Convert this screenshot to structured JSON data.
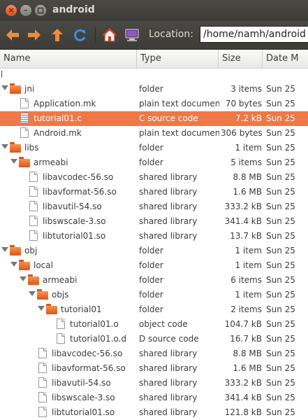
{
  "window": {
    "title": "android",
    "close_glyph": "×",
    "min_glyph": "–"
  },
  "toolbar": {
    "location_label": "Location:",
    "location_value": "/home/namh/android"
  },
  "columns": {
    "name": "Name",
    "type": "Type",
    "size": "Size",
    "date": "Date M"
  },
  "rows": [
    {
      "name": "jni",
      "type": "folder",
      "size": "3 items",
      "date": "Sun 25",
      "depth": 0,
      "kind": "folder",
      "expanded": true
    },
    {
      "name": "Application.mk",
      "type": "plain text document",
      "size": "70 bytes",
      "date": "Sun 25",
      "depth": 1,
      "kind": "file"
    },
    {
      "name": "tutorial01.c",
      "type": "C source code",
      "size": "7.2 kB",
      "date": "Sun 25",
      "depth": 1,
      "kind": "cfile",
      "selected": true
    },
    {
      "name": "Android.mk",
      "type": "plain text document",
      "size": "306 bytes",
      "date": "Sun 25",
      "depth": 1,
      "kind": "file"
    },
    {
      "name": "libs",
      "type": "folder",
      "size": "1 item",
      "date": "Sun 25",
      "depth": 0,
      "kind": "folder",
      "expanded": true
    },
    {
      "name": "armeabi",
      "type": "folder",
      "size": "5 items",
      "date": "Sun 25",
      "depth": 1,
      "kind": "folder",
      "expanded": true
    },
    {
      "name": "libavcodec-56.so",
      "type": "shared library",
      "size": "8.8 MB",
      "date": "Sun 25",
      "depth": 2,
      "kind": "file"
    },
    {
      "name": "libavformat-56.so",
      "type": "shared library",
      "size": "1.6 MB",
      "date": "Sun 25",
      "depth": 2,
      "kind": "file"
    },
    {
      "name": "libavutil-54.so",
      "type": "shared library",
      "size": "333.2 kB",
      "date": "Sun 25",
      "depth": 2,
      "kind": "file"
    },
    {
      "name": "libswscale-3.so",
      "type": "shared library",
      "size": "341.4 kB",
      "date": "Sun 25",
      "depth": 2,
      "kind": "file"
    },
    {
      "name": "libtutorial01.so",
      "type": "shared library",
      "size": "13.7 kB",
      "date": "Sun 25",
      "depth": 2,
      "kind": "file"
    },
    {
      "name": "obj",
      "type": "folder",
      "size": "1 item",
      "date": "Sun 25",
      "depth": 0,
      "kind": "folder",
      "expanded": true
    },
    {
      "name": "local",
      "type": "folder",
      "size": "1 item",
      "date": "Sun 25",
      "depth": 1,
      "kind": "folder",
      "expanded": true
    },
    {
      "name": "armeabi",
      "type": "folder",
      "size": "6 items",
      "date": "Sun 25",
      "depth": 2,
      "kind": "folder",
      "expanded": true
    },
    {
      "name": "objs",
      "type": "folder",
      "size": "1 item",
      "date": "Sun 25",
      "depth": 3,
      "kind": "folder",
      "expanded": true
    },
    {
      "name": "tutorial01",
      "type": "folder",
      "size": "2 items",
      "date": "Sun 25",
      "depth": 4,
      "kind": "folder",
      "expanded": true
    },
    {
      "name": "tutorial01.o",
      "type": "object code",
      "size": "104.7 kB",
      "date": "Sun 25",
      "depth": 5,
      "kind": "file"
    },
    {
      "name": "tutorial01.o.d",
      "type": "D source code",
      "size": "16.7 kB",
      "date": "Sun 25",
      "depth": 5,
      "kind": "file"
    },
    {
      "name": "libavcodec-56.so",
      "type": "shared library",
      "size": "8.8 MB",
      "date": "Sun 25",
      "depth": 3,
      "kind": "file"
    },
    {
      "name": "libavformat-56.so",
      "type": "shared library",
      "size": "1.6 MB",
      "date": "Sun 25",
      "depth": 3,
      "kind": "file"
    },
    {
      "name": "libavutil-54.so",
      "type": "shared library",
      "size": "333.2 kB",
      "date": "Sun 25",
      "depth": 3,
      "kind": "file"
    },
    {
      "name": "libswscale-3.so",
      "type": "shared library",
      "size": "341.4 kB",
      "date": "Sun 25",
      "depth": 3,
      "kind": "file"
    },
    {
      "name": "libtutorial01.so",
      "type": "shared library",
      "size": "121.8 kB",
      "date": "Sun 25",
      "depth": 3,
      "kind": "file"
    }
  ],
  "colors": {
    "accent": "#f07746",
    "toolbar_bg": "#3c3b37",
    "folder": "#e8672b"
  },
  "icons": [
    "close-icon",
    "minimize-icon",
    "maximize-icon",
    "back-arrow-icon",
    "forward-arrow-icon",
    "up-arrow-icon",
    "reload-icon",
    "home-icon",
    "computer-icon",
    "folder-icon",
    "file-icon",
    "c-source-file-icon",
    "expander-triangle-icon"
  ]
}
